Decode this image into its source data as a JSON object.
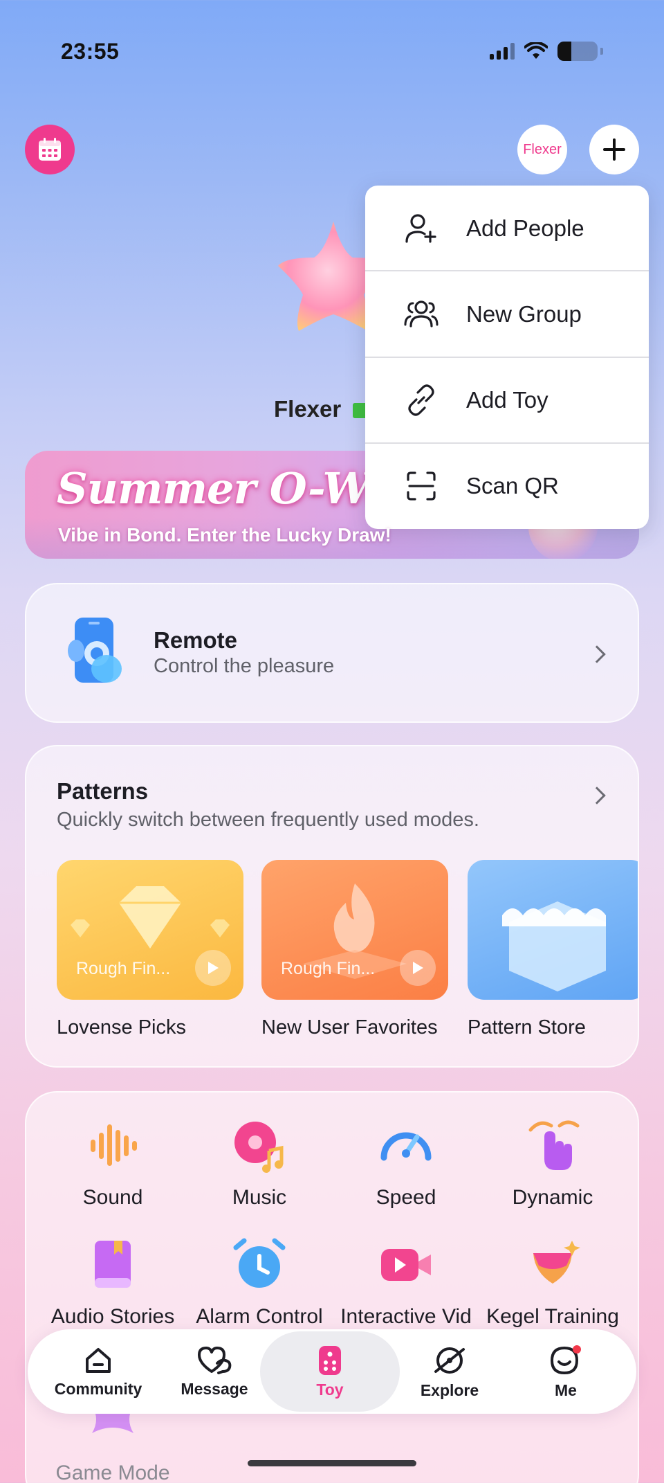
{
  "status_bar": {
    "time": "23:55",
    "battery_level": 0.35
  },
  "header": {
    "profile_name": "Flexer"
  },
  "device": {
    "name": "Flexer"
  },
  "banner": {
    "title": "Summer O-Wave",
    "subtitle": "Vibe in Bond. Enter the Lucky Draw!"
  },
  "remote": {
    "title": "Remote",
    "subtitle": "Control the pleasure"
  },
  "patterns": {
    "title": "Patterns",
    "subtitle": "Quickly switch between frequently used modes.",
    "items": [
      {
        "label": "Lovense Picks",
        "overlay": "Rough Fin..."
      },
      {
        "label": "New User Favorites",
        "overlay": "Rough Fin..."
      },
      {
        "label": "Pattern Store",
        "overlay": ""
      }
    ]
  },
  "features": [
    {
      "label": "Sound",
      "icon": "sound-wave-icon"
    },
    {
      "label": "Music",
      "icon": "music-disc-icon"
    },
    {
      "label": "Speed",
      "icon": "speedometer-icon"
    },
    {
      "label": "Dynamic",
      "icon": "hand-tap-icon"
    },
    {
      "label": "Audio Stories",
      "icon": "book-icon"
    },
    {
      "label": "Alarm Control",
      "icon": "alarm-clock-icon"
    },
    {
      "label": "Interactive Vid",
      "icon": "video-camera-icon"
    },
    {
      "label": "Kegel Training",
      "icon": "kegel-icon"
    },
    {
      "label": "Game Mode",
      "icon": "game-icon"
    }
  ],
  "tabbar": {
    "items": [
      {
        "label": "Community",
        "icon": "home-icon"
      },
      {
        "label": "Message",
        "icon": "heart-chat-icon"
      },
      {
        "label": "Toy",
        "icon": "remote-icon"
      },
      {
        "label": "Explore",
        "icon": "planet-icon"
      },
      {
        "label": "Me",
        "icon": "face-icon"
      }
    ],
    "active": "Toy"
  },
  "dropdown_menu": {
    "items": [
      {
        "label": "Add People",
        "icon": "add-person-icon"
      },
      {
        "label": "New Group",
        "icon": "group-icon"
      },
      {
        "label": "Add Toy",
        "icon": "link-icon"
      },
      {
        "label": "Scan QR",
        "icon": "scan-icon"
      }
    ]
  },
  "colors": {
    "accent": "#ef3a8d",
    "text": "#1d1d24",
    "secondary_text": "#5f6068"
  }
}
